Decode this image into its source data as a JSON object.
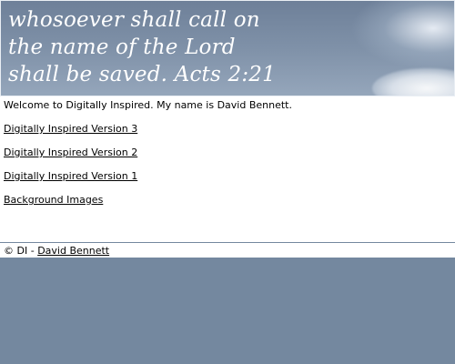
{
  "banner": {
    "quote_lines": [
      "whosoever shall call on",
      "the name of the Lord",
      "shall be saved. Acts 2:21"
    ]
  },
  "main": {
    "welcome_text": "Welcome to Digitally Inspired. My name is David Bennett.",
    "links": [
      "Digitally Inspired Version 3",
      "Digitally Inspired Version 2",
      "Digitally Inspired Version 1",
      "Background Images"
    ]
  },
  "footer": {
    "copyright_text": "© DI - ",
    "author_link": "David Bennett"
  },
  "colors": {
    "page_background": "#74889f",
    "content_background": "#ffffff",
    "text": "#000000",
    "banner_text": "#ffffff"
  }
}
